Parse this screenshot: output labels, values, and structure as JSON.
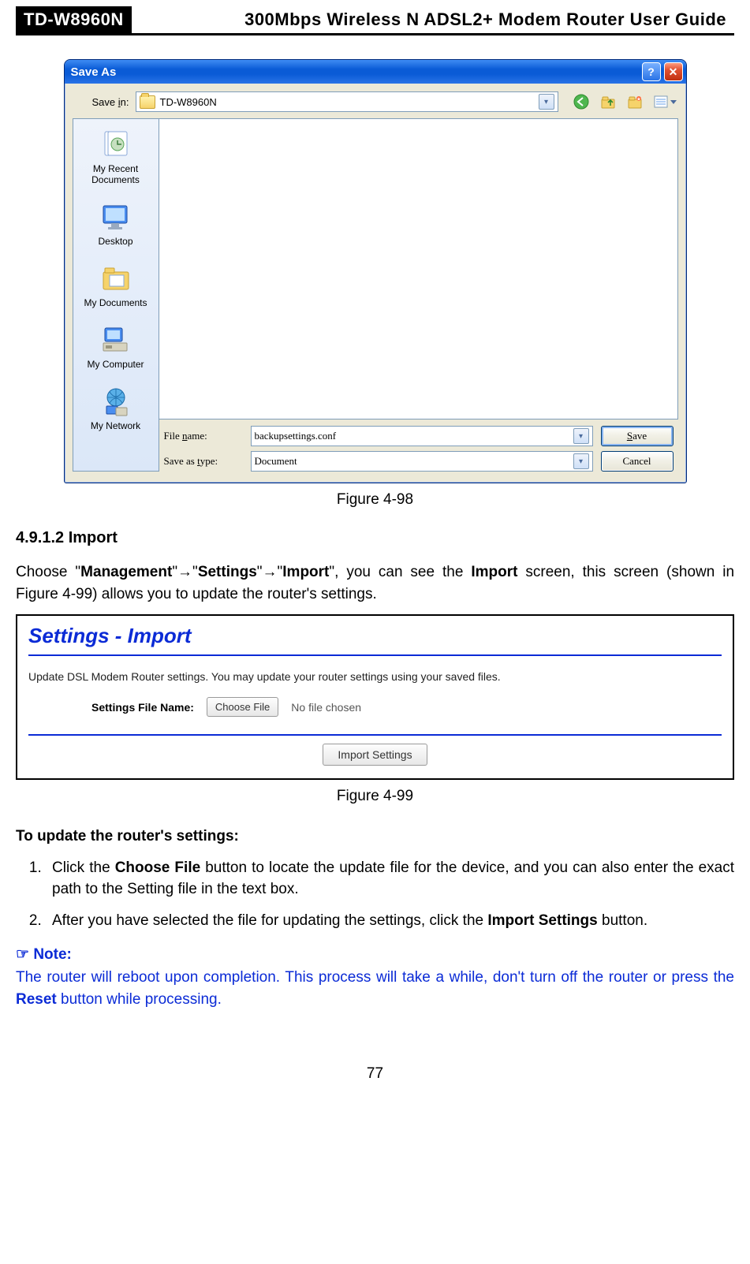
{
  "header": {
    "model": "TD-W8960N",
    "title": "300Mbps Wireless N ADSL2+ Modem Router User Guide"
  },
  "dialog": {
    "title": "Save As",
    "save_in_label": "Save in:",
    "save_in_value": "TD-W8960N",
    "places": [
      {
        "label": "My Recent Documents"
      },
      {
        "label": "Desktop"
      },
      {
        "label": "My Documents"
      },
      {
        "label": "My Computer"
      },
      {
        "label": "My Network"
      }
    ],
    "file_name_label": "File name:",
    "file_name_value": "backupsettings.conf",
    "save_type_label": "Save as type:",
    "save_type_value": "Document",
    "btn_save": "Save",
    "btn_cancel": "Cancel"
  },
  "fig98": "Figure 4-98",
  "section_heading": "4.9.1.2    Import",
  "para1_a": "Choose \"",
  "para1_m": "Management",
  "para1_b": "\"→\"",
  "para1_s": "Settings",
  "para1_c": "\"→\"",
  "para1_i": "Import",
  "para1_d": "\", you can see the ",
  "para1_imp": "Import",
  "para1_e": " screen, this screen (shown in Figure 4-99) allows you to update the router's settings.",
  "panel": {
    "heading": "Settings - Import",
    "desc": "Update DSL Modem Router settings. You may update your router settings using your saved files.",
    "file_label": "Settings File Name:",
    "choose_btn": "Choose File",
    "no_file": "No file chosen",
    "import_btn": "Import Settings"
  },
  "fig99": "Figure 4-99",
  "update_heading": "To update the router's settings:",
  "step1_a": "Click the ",
  "step1_b": "Choose File",
  "step1_c": " button to locate the update file for the device, and you can also enter the exact path to the Setting file in the text box.",
  "step2_a": "After you have selected the file for updating the settings, click the ",
  "step2_b": "Import Settings",
  "step2_c": " button.",
  "note_label": "Note:",
  "note_body_a": "The router will reboot upon completion. This process will take a while, don't turn off the router or press the ",
  "note_body_b": "Reset",
  "note_body_c": " button while processing.",
  "page_number": "77"
}
